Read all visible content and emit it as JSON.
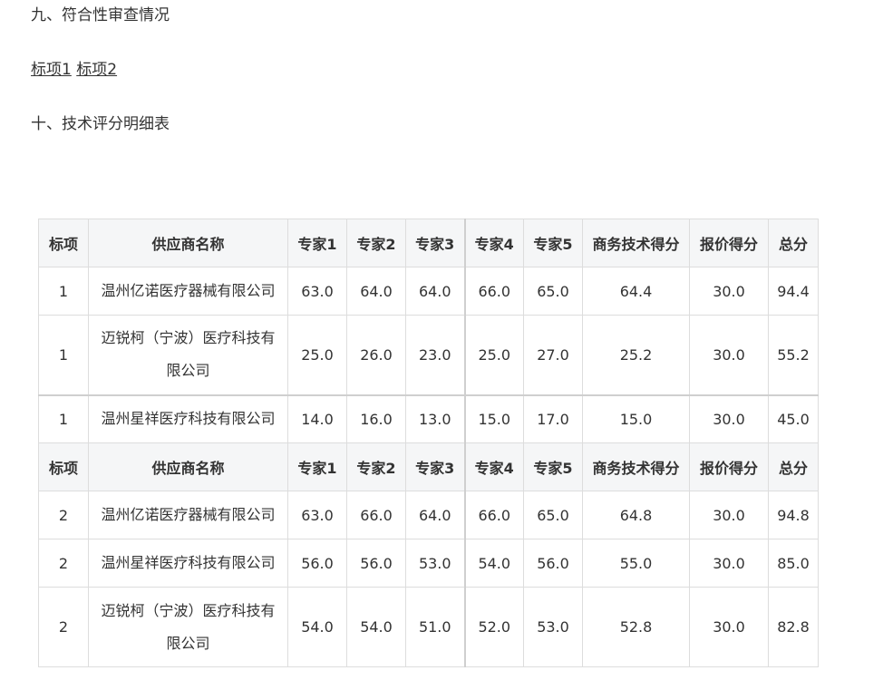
{
  "section_nine": {
    "title": "九、符合性审查情况",
    "links": [
      "标项1",
      "标项2"
    ]
  },
  "section_ten": {
    "title": "十、技术评分明细表"
  },
  "table": {
    "header": [
      "标项",
      "供应商名称",
      "专家1",
      "专家2",
      "专家3",
      "专家4",
      "专家5",
      "商务技术得分",
      "报价得分",
      "总分"
    ],
    "lot1": [
      [
        "1",
        "温州亿诺医疗器械有限公司",
        "63.0",
        "64.0",
        "64.0",
        "66.0",
        "65.0",
        "64.4",
        "30.0",
        "94.4"
      ],
      [
        "1",
        "迈锐柯（宁波）医疗科技有限公司",
        "25.0",
        "26.0",
        "23.0",
        "25.0",
        "27.0",
        "25.2",
        "30.0",
        "55.2"
      ],
      [
        "1",
        "温州星祥医疗科技有限公司",
        "14.0",
        "16.0",
        "13.0",
        "15.0",
        "17.0",
        "15.0",
        "30.0",
        "45.0"
      ]
    ],
    "lot2": [
      [
        "2",
        "温州亿诺医疗器械有限公司",
        "63.0",
        "66.0",
        "64.0",
        "66.0",
        "65.0",
        "64.8",
        "30.0",
        "94.8"
      ],
      [
        "2",
        "温州星祥医疗科技有限公司",
        "56.0",
        "56.0",
        "53.0",
        "54.0",
        "56.0",
        "55.0",
        "30.0",
        "85.0"
      ],
      [
        "2",
        "迈锐柯（宁波）医疗科技有限公司",
        "54.0",
        "54.0",
        "51.0",
        "52.0",
        "53.0",
        "52.8",
        "30.0",
        "82.8"
      ]
    ]
  }
}
